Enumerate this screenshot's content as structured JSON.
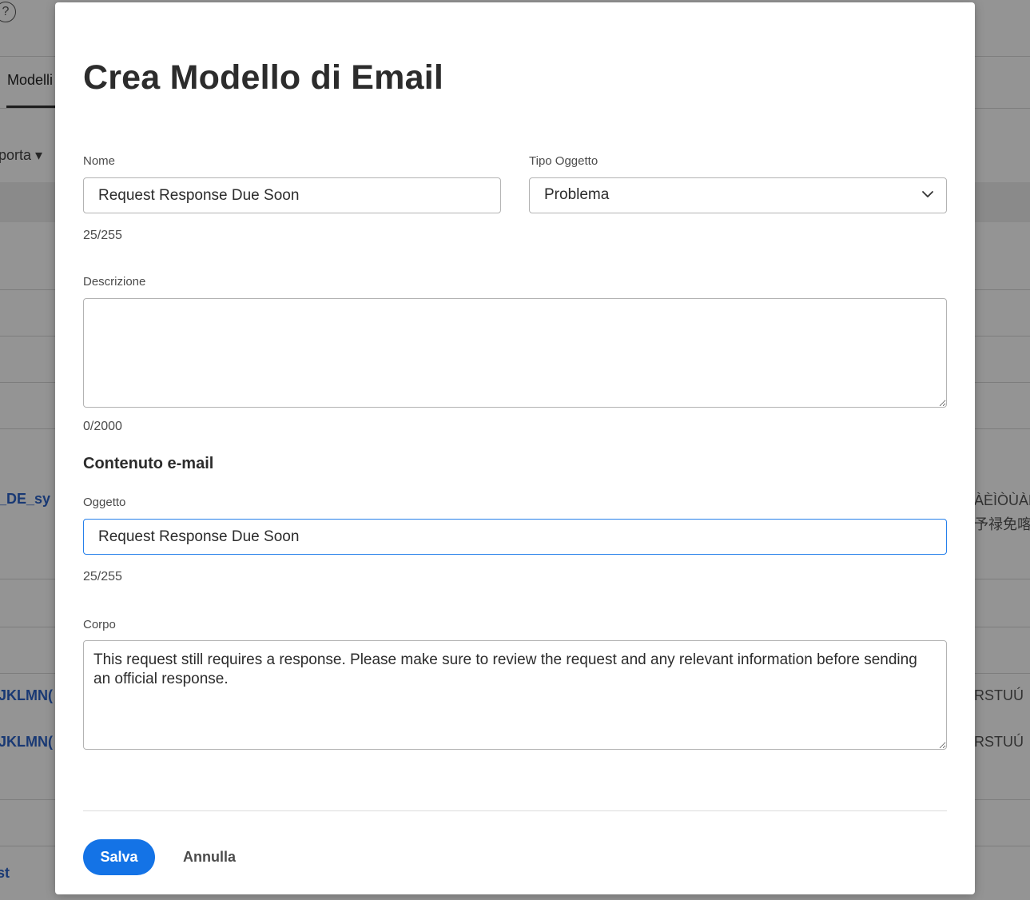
{
  "background": {
    "help_icon_glyph": "?",
    "tab_label": "Modelli",
    "export_label": "porta ▾",
    "links": [
      "_DE_sy",
      "JKLMN(",
      "JKLMN(",
      "st"
    ],
    "right_texts": [
      "ÀÈÌÒÙÀÈ",
      "予禄免喀",
      "RSTUÚ",
      "RSTUÚ"
    ]
  },
  "dialog": {
    "title": "Crea Modello di Email",
    "name": {
      "label": "Nome",
      "value": "Request Response Due Soon",
      "counter": "25/255"
    },
    "object_type": {
      "label": "Tipo Oggetto",
      "selected": "Problema",
      "icon": "chevron-down-icon"
    },
    "description": {
      "label": "Descrizione",
      "value": "",
      "counter": "0/2000"
    },
    "email_content": {
      "heading": "Contenuto e-mail",
      "subject": {
        "label": "Oggetto",
        "value": "Request Response Due Soon",
        "counter": "25/255"
      },
      "body": {
        "label": "Corpo",
        "value": "This request still requires a response. Please make sure to review the request and any relevant information before sending an official response."
      }
    },
    "buttons": {
      "save": "Salva",
      "cancel": "Annulla"
    }
  },
  "colors": {
    "primary": "#1473e6",
    "focus_border": "#2680eb",
    "link": "#2b62c9"
  }
}
